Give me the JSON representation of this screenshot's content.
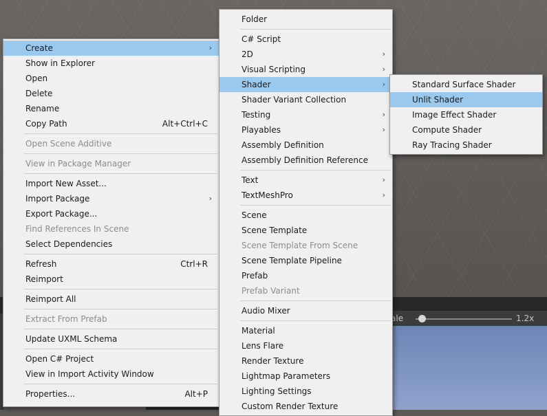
{
  "main_menu": {
    "items": [
      {
        "label": "Create",
        "arrow": "›",
        "selected": true
      },
      {
        "label": "Show in Explorer"
      },
      {
        "label": "Open"
      },
      {
        "label": "Delete"
      },
      {
        "label": "Rename"
      },
      {
        "label": "Copy Path",
        "shortcut": "Alt+Ctrl+C"
      },
      {
        "label": "Open Scene Additive",
        "disabled": true
      },
      {
        "label": "View in Package Manager",
        "disabled": true
      },
      {
        "label": "Import New Asset..."
      },
      {
        "label": "Import Package",
        "arrow": "›"
      },
      {
        "label": "Export Package..."
      },
      {
        "label": "Find References In Scene",
        "disabled": true
      },
      {
        "label": "Select Dependencies"
      },
      {
        "label": "Refresh",
        "shortcut": "Ctrl+R"
      },
      {
        "label": "Reimport"
      },
      {
        "label": "Reimport All"
      },
      {
        "label": "Extract From Prefab",
        "disabled": true
      },
      {
        "label": "Update UXML Schema"
      },
      {
        "label": "Open C# Project"
      },
      {
        "label": "View in Import Activity Window"
      },
      {
        "label": "Properties...",
        "shortcut": "Alt+P"
      }
    ]
  },
  "create_menu": {
    "items": [
      {
        "label": "Folder"
      },
      {
        "label": "C# Script"
      },
      {
        "label": "2D",
        "arrow": "›"
      },
      {
        "label": "Visual Scripting",
        "arrow": "›"
      },
      {
        "label": "Shader",
        "arrow": "›",
        "selected": true
      },
      {
        "label": "Shader Variant Collection"
      },
      {
        "label": "Testing",
        "arrow": "›"
      },
      {
        "label": "Playables",
        "arrow": "›"
      },
      {
        "label": "Assembly Definition"
      },
      {
        "label": "Assembly Definition Reference"
      },
      {
        "label": "Text",
        "arrow": "›"
      },
      {
        "label": "TextMeshPro",
        "arrow": "›"
      },
      {
        "label": "Scene"
      },
      {
        "label": "Scene Template"
      },
      {
        "label": "Scene Template From Scene",
        "disabled": true
      },
      {
        "label": "Scene Template Pipeline"
      },
      {
        "label": "Prefab"
      },
      {
        "label": "Prefab Variant",
        "disabled": true
      },
      {
        "label": "Audio Mixer"
      },
      {
        "label": "Material"
      },
      {
        "label": "Lens Flare"
      },
      {
        "label": "Render Texture"
      },
      {
        "label": "Lightmap Parameters"
      },
      {
        "label": "Lighting Settings"
      },
      {
        "label": "Custom Render Texture"
      }
    ]
  },
  "shader_menu": {
    "items": [
      {
        "label": "Standard Surface Shader"
      },
      {
        "label": "Unlit Shader",
        "selected": true
      },
      {
        "label": "Image Effect Shader"
      },
      {
        "label": "Compute Shader"
      },
      {
        "label": "Ray Tracing Shader"
      }
    ]
  },
  "scene_toolbar": {
    "scale_label": "ale",
    "scale_value": "1.2x"
  },
  "colors": {
    "selection": "#99c9ef",
    "menu_bg": "#f0f0f0",
    "disabled_text": "#8c8c8c"
  }
}
